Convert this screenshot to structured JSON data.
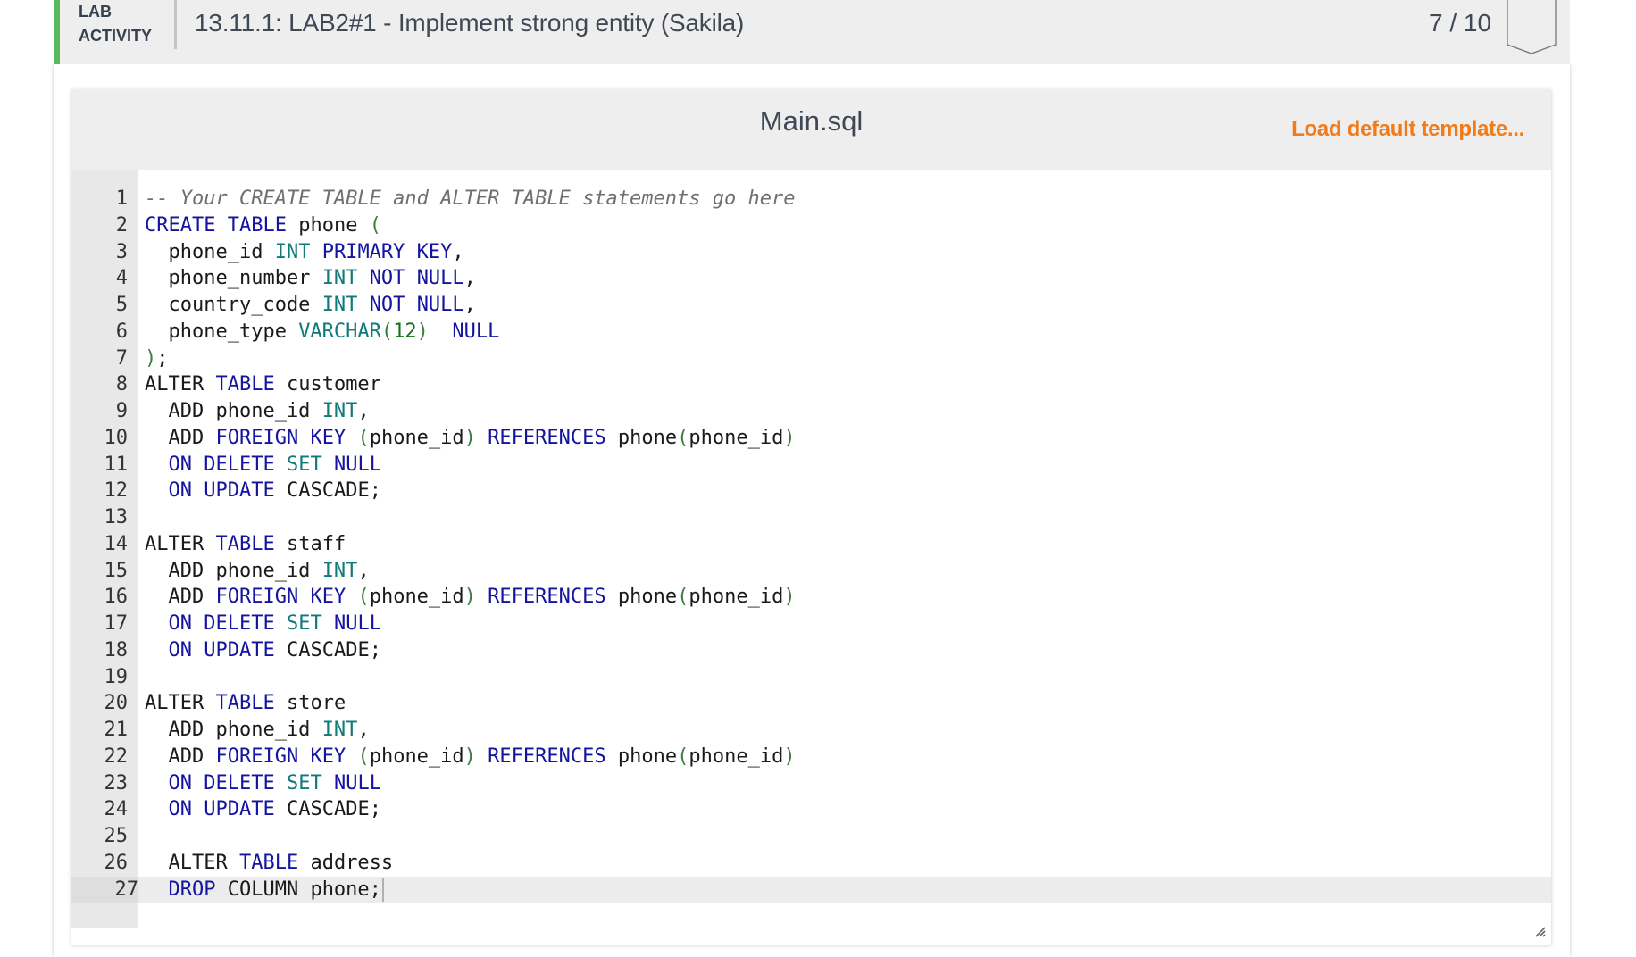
{
  "lab": {
    "label_line1": "LAB",
    "label_line2": "ACTIVITY",
    "title": "13.11.1: LAB2#1 - Implement strong entity (Sakila)",
    "score": "7 / 10",
    "accent_color": "#5cb85c"
  },
  "editor": {
    "file_name": "Main.sql",
    "load_template_label": "Load default template...",
    "load_template_color": "#f27b18",
    "active_line": 27,
    "lines": [
      [
        [
          "-- Your CREATE TABLE and ALTER TABLE statements go here",
          "comment"
        ]
      ],
      [
        [
          "CREATE",
          "kw"
        ],
        [
          " ",
          "plain"
        ],
        [
          "TABLE",
          "kw"
        ],
        [
          " phone ",
          "plain"
        ],
        [
          "(",
          "paren"
        ]
      ],
      [
        [
          "  phone_id ",
          "plain"
        ],
        [
          "INT",
          "type"
        ],
        [
          " ",
          "plain"
        ],
        [
          "PRIMARY",
          "kw"
        ],
        [
          " ",
          "plain"
        ],
        [
          "KEY",
          "kw"
        ],
        [
          ",",
          "plain"
        ]
      ],
      [
        [
          "  phone_number ",
          "plain"
        ],
        [
          "INT",
          "type"
        ],
        [
          " ",
          "plain"
        ],
        [
          "NOT",
          "kw"
        ],
        [
          " ",
          "plain"
        ],
        [
          "NULL",
          "kw"
        ],
        [
          ",",
          "plain"
        ]
      ],
      [
        [
          "  country_code ",
          "plain"
        ],
        [
          "INT",
          "type"
        ],
        [
          " ",
          "plain"
        ],
        [
          "NOT",
          "kw"
        ],
        [
          " ",
          "plain"
        ],
        [
          "NULL",
          "kw"
        ],
        [
          ",",
          "plain"
        ]
      ],
      [
        [
          "  phone_type ",
          "plain"
        ],
        [
          "VARCHAR",
          "type"
        ],
        [
          "(",
          "paren"
        ],
        [
          "12",
          "num"
        ],
        [
          ")",
          "paren"
        ],
        [
          "  ",
          "plain"
        ],
        [
          "NULL",
          "kw"
        ]
      ],
      [
        [
          ")",
          "paren"
        ],
        [
          ";",
          "plain"
        ]
      ],
      [
        [
          "ALTER ",
          "plain"
        ],
        [
          "TABLE",
          "kw"
        ],
        [
          " customer",
          "plain"
        ]
      ],
      [
        [
          "  ADD phone_id ",
          "plain"
        ],
        [
          "INT",
          "type"
        ],
        [
          ",",
          "plain"
        ]
      ],
      [
        [
          "  ADD ",
          "plain"
        ],
        [
          "FOREIGN",
          "kw"
        ],
        [
          " ",
          "plain"
        ],
        [
          "KEY",
          "kw"
        ],
        [
          " ",
          "plain"
        ],
        [
          "(",
          "paren"
        ],
        [
          "phone_id",
          "plain"
        ],
        [
          ")",
          "paren"
        ],
        [
          " ",
          "plain"
        ],
        [
          "REFERENCES",
          "kw"
        ],
        [
          " phone",
          "plain"
        ],
        [
          "(",
          "paren"
        ],
        [
          "phone_id",
          "plain"
        ],
        [
          ")",
          "paren"
        ]
      ],
      [
        [
          "  ",
          "plain"
        ],
        [
          "ON",
          "kw"
        ],
        [
          " ",
          "plain"
        ],
        [
          "DELETE",
          "kw"
        ],
        [
          " ",
          "plain"
        ],
        [
          "SET",
          "type"
        ],
        [
          " ",
          "plain"
        ],
        [
          "NULL",
          "kw"
        ]
      ],
      [
        [
          "  ",
          "plain"
        ],
        [
          "ON",
          "kw"
        ],
        [
          " ",
          "plain"
        ],
        [
          "UPDATE",
          "kw"
        ],
        [
          " CASCADE;",
          "plain"
        ]
      ],
      [],
      [
        [
          "ALTER ",
          "plain"
        ],
        [
          "TABLE",
          "kw"
        ],
        [
          " staff",
          "plain"
        ]
      ],
      [
        [
          "  ADD phone_id ",
          "plain"
        ],
        [
          "INT",
          "type"
        ],
        [
          ",",
          "plain"
        ]
      ],
      [
        [
          "  ADD ",
          "plain"
        ],
        [
          "FOREIGN",
          "kw"
        ],
        [
          " ",
          "plain"
        ],
        [
          "KEY",
          "kw"
        ],
        [
          " ",
          "plain"
        ],
        [
          "(",
          "paren"
        ],
        [
          "phone_id",
          "plain"
        ],
        [
          ")",
          "paren"
        ],
        [
          " ",
          "plain"
        ],
        [
          "REFERENCES",
          "kw"
        ],
        [
          " phone",
          "plain"
        ],
        [
          "(",
          "paren"
        ],
        [
          "phone_id",
          "plain"
        ],
        [
          ")",
          "paren"
        ]
      ],
      [
        [
          "  ",
          "plain"
        ],
        [
          "ON",
          "kw"
        ],
        [
          " ",
          "plain"
        ],
        [
          "DELETE",
          "kw"
        ],
        [
          " ",
          "plain"
        ],
        [
          "SET",
          "type"
        ],
        [
          " ",
          "plain"
        ],
        [
          "NULL",
          "kw"
        ]
      ],
      [
        [
          "  ",
          "plain"
        ],
        [
          "ON",
          "kw"
        ],
        [
          " ",
          "plain"
        ],
        [
          "UPDATE",
          "kw"
        ],
        [
          " CASCADE;",
          "plain"
        ]
      ],
      [],
      [
        [
          "ALTER ",
          "plain"
        ],
        [
          "TABLE",
          "kw"
        ],
        [
          " store",
          "plain"
        ]
      ],
      [
        [
          "  ADD phone_id ",
          "plain"
        ],
        [
          "INT",
          "type"
        ],
        [
          ",",
          "plain"
        ]
      ],
      [
        [
          "  ADD ",
          "plain"
        ],
        [
          "FOREIGN",
          "kw"
        ],
        [
          " ",
          "plain"
        ],
        [
          "KEY",
          "kw"
        ],
        [
          " ",
          "plain"
        ],
        [
          "(",
          "paren"
        ],
        [
          "phone_id",
          "plain"
        ],
        [
          ")",
          "paren"
        ],
        [
          " ",
          "plain"
        ],
        [
          "REFERENCES",
          "kw"
        ],
        [
          " phone",
          "plain"
        ],
        [
          "(",
          "paren"
        ],
        [
          "phone_id",
          "plain"
        ],
        [
          ")",
          "paren"
        ]
      ],
      [
        [
          "  ",
          "plain"
        ],
        [
          "ON",
          "kw"
        ],
        [
          " ",
          "plain"
        ],
        [
          "DELETE",
          "kw"
        ],
        [
          " ",
          "plain"
        ],
        [
          "SET",
          "type"
        ],
        [
          " ",
          "plain"
        ],
        [
          "NULL",
          "kw"
        ]
      ],
      [
        [
          "  ",
          "plain"
        ],
        [
          "ON",
          "kw"
        ],
        [
          " ",
          "plain"
        ],
        [
          "UPDATE",
          "kw"
        ],
        [
          " CASCADE;",
          "plain"
        ]
      ],
      [],
      [
        [
          "  ALTER ",
          "plain"
        ],
        [
          "TABLE",
          "kw"
        ],
        [
          " address",
          "plain"
        ]
      ],
      [
        [
          "  ",
          "plain"
        ],
        [
          "DROP",
          "kw"
        ],
        [
          " COLUMN phone;",
          "plain"
        ]
      ]
    ]
  }
}
